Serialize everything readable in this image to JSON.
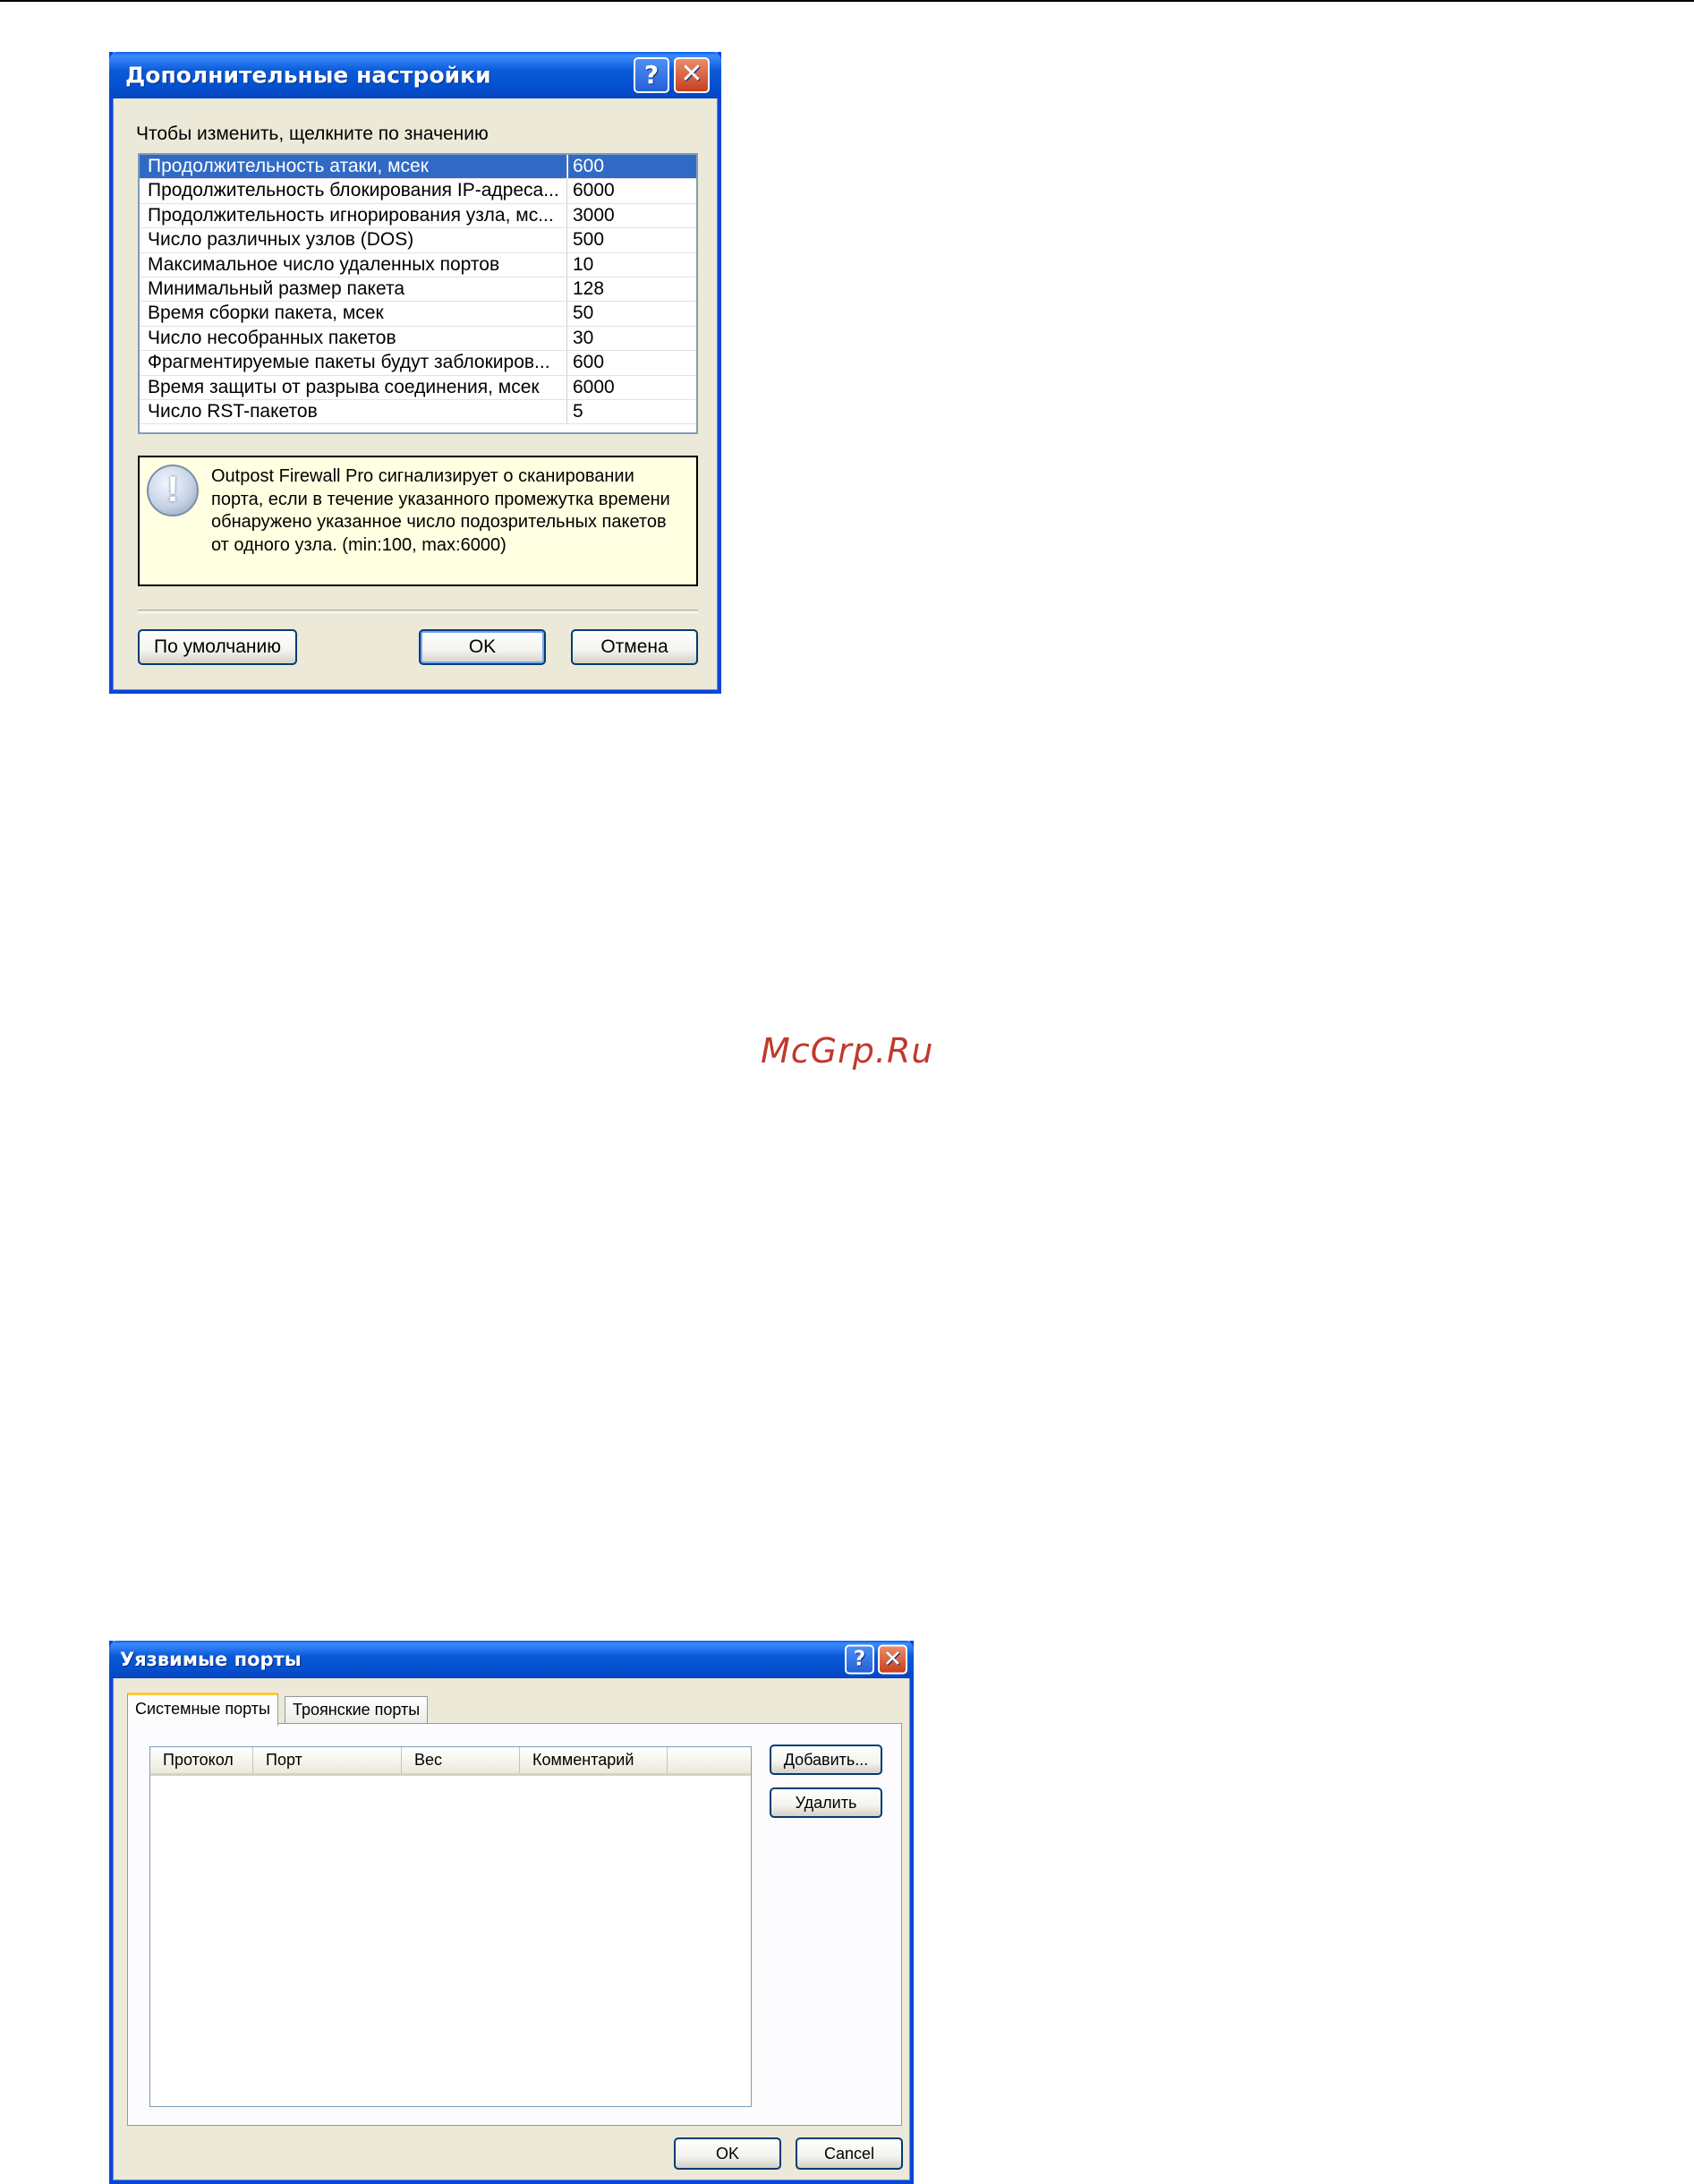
{
  "watermark": "McGrp.Ru",
  "dialog1": {
    "title": "Дополнительные настройки",
    "help_glyph": "?",
    "close_glyph": "✕",
    "prompt": "Чтобы изменить, щелкните по значению",
    "rows": [
      {
        "name": "Продолжительность атаки, мсек",
        "value": "600"
      },
      {
        "name": "Продолжительность блокирования IP-адреса...",
        "value": "6000"
      },
      {
        "name": "Продолжительность игнорирования узла, мс...",
        "value": "3000"
      },
      {
        "name": "Число различных узлов (DOS)",
        "value": "500"
      },
      {
        "name": "Максимальное число удаленных портов",
        "value": "10"
      },
      {
        "name": "Минимальный размер пакета",
        "value": "128"
      },
      {
        "name": "Время сборки пакета, мсек",
        "value": "50"
      },
      {
        "name": "Число несобранных пакетов",
        "value": "30"
      },
      {
        "name": "Фрагментируемые пакеты будут заблокиров...",
        "value": "600"
      },
      {
        "name": "Время защиты от разрыва соединения, мсек",
        "value": "6000"
      },
      {
        "name": "Число RST-пакетов",
        "value": "5"
      }
    ],
    "info_icon": "exclamation-icon",
    "info_text": "Outpost Firewall Pro сигнализирует о сканировании порта, если в течение указанного промежутка времени обнаружено указанное число подозрительных пакетов от одного узла. (min:100, max:6000)",
    "buttons": {
      "default": "По умолчанию",
      "ok": "OK",
      "cancel": "Отмена"
    }
  },
  "dialog2": {
    "title": "Уязвимые порты",
    "help_glyph": "?",
    "close_glyph": "✕",
    "tabs": [
      "Системные порты",
      "Троянские порты"
    ],
    "columns": [
      "Протокол",
      "Порт",
      "Вес",
      "Комментарий"
    ],
    "buttons": {
      "add": "Добавить...",
      "delete": "Удалить",
      "ok": "OK",
      "cancel": "Cancel"
    }
  },
  "colors": {
    "titlebar": "#0a5fe8",
    "selection": "#316ac5",
    "info_bg": "#ffffe1",
    "watermark": "#c0392b"
  }
}
